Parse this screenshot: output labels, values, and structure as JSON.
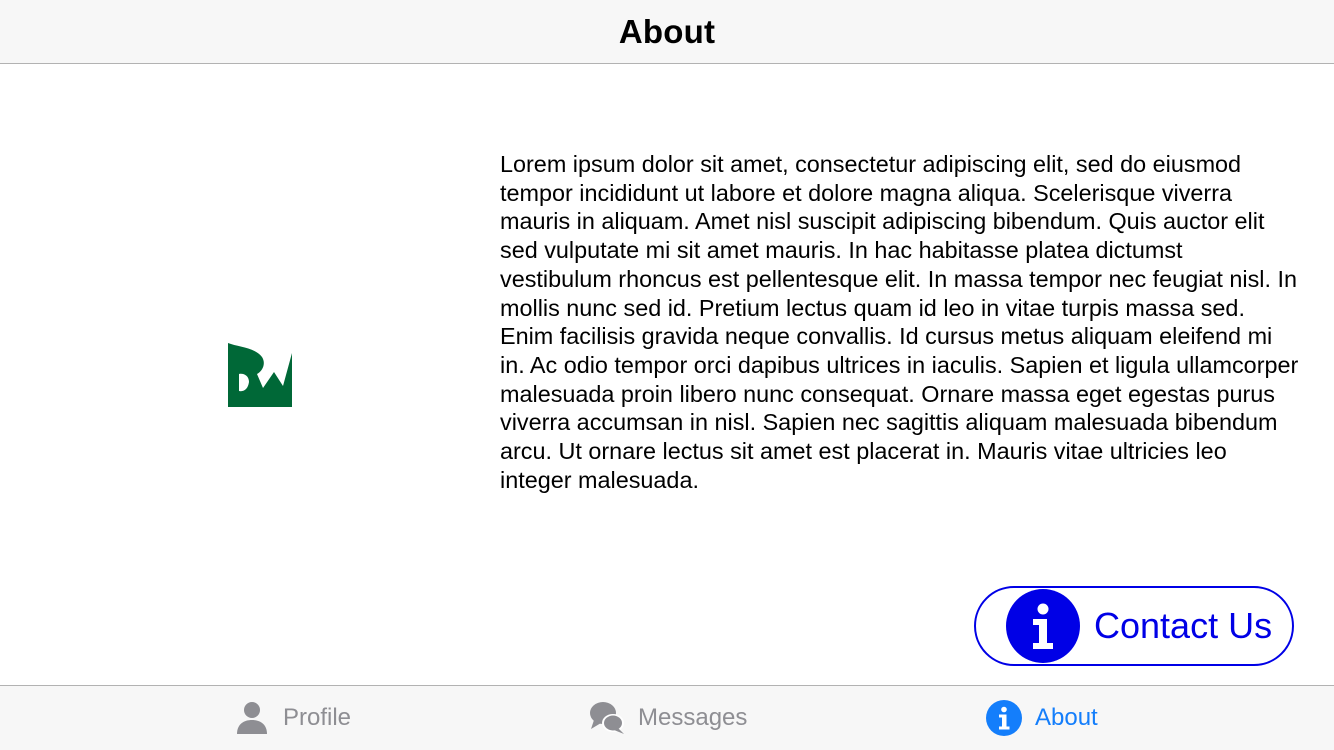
{
  "nav_bar": {
    "title": "About"
  },
  "about": {
    "logo_icon": "raywenderlich-logo-icon",
    "description": "Lorem ipsum dolor sit amet, consectetur adipiscing elit, sed do eiusmod tempor incididunt ut labore et dolore magna aliqua. Scelerisque viverra mauris in aliquam. Amet nisl suscipit adipiscing bibendum. Quis auctor elit sed vulputate mi sit amet mauris. In hac habitasse platea dictumst vestibulum rhoncus est pellentesque elit. In massa tempor nec feugiat nisl. In mollis nunc sed id. Pretium lectus quam id leo in vitae turpis massa sed. Enim facilisis gravida neque convallis. Id cursus metus aliquam eleifend mi in. Ac odio tempor orci dapibus ultrices in iaculis. Sapien et ligula ullamcorper malesuada proin libero nunc consequat. Ornare massa eget egestas purus viverra accumsan in nisl. Sapien nec sagittis aliquam malesuada bibendum arcu. Ut ornare lectus sit amet est placerat in. Mauris vitae ultricies leo integer malesuada.",
    "contact_button": {
      "label": "Contact Us",
      "icon": "info-icon"
    }
  },
  "tab_bar": {
    "items": [
      {
        "label": "Profile",
        "icon": "person-icon",
        "selected": false
      },
      {
        "label": "Messages",
        "icon": "chat-bubbles-icon",
        "selected": false
      },
      {
        "label": "About",
        "icon": "info-icon",
        "selected": true
      }
    ]
  },
  "colors": {
    "logo_green": "#006837",
    "button_blue": "#0000e6",
    "tab_selected": "#147efb",
    "tab_unselected": "#8e8e93",
    "bar_background": "#f7f7f7"
  }
}
